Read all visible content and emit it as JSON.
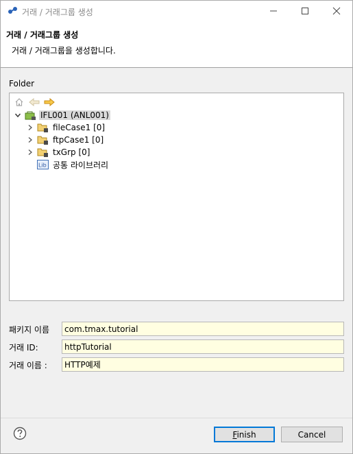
{
  "window": {
    "title": "거래 / 거래그룹 생성",
    "controls": [
      "minimize",
      "maximize",
      "close"
    ]
  },
  "header": {
    "title": "거래 / 거래그룹 생성",
    "description": "거래 / 거래그룹을 생성합니다."
  },
  "folder": {
    "label": "Folder",
    "toolbar": [
      "home-icon",
      "back-arrow-icon",
      "forward-arrow-icon"
    ],
    "tree": [
      {
        "label": "IFL001  (ANL001)",
        "icon": "project-icon",
        "expanded": true,
        "selected": true
      },
      {
        "label": "fileCase1 [0]",
        "icon": "package-folder-icon",
        "expanded": false
      },
      {
        "label": "ftpCase1 [0]",
        "icon": "package-folder-icon",
        "expanded": false
      },
      {
        "label": "txGrp [0]",
        "icon": "package-folder-icon",
        "expanded": false
      },
      {
        "label": "공통 라이브러리",
        "icon": "library-icon"
      }
    ]
  },
  "form": {
    "package_label": "패키지 이름",
    "package_value": "com.tmax.tutorial",
    "txid_label": "거래 ID:",
    "txid_value": "httpTutorial",
    "txname_label": "거래 이름  :",
    "txname_value": "HTTP예제"
  },
  "footer": {
    "help_icon": "help-icon",
    "finish_label": "Finish",
    "cancel_label": "Cancel"
  },
  "colors": {
    "input_background": "#fffee1",
    "selection": "#d9d9d9",
    "default_button_border": "#0078d7"
  }
}
